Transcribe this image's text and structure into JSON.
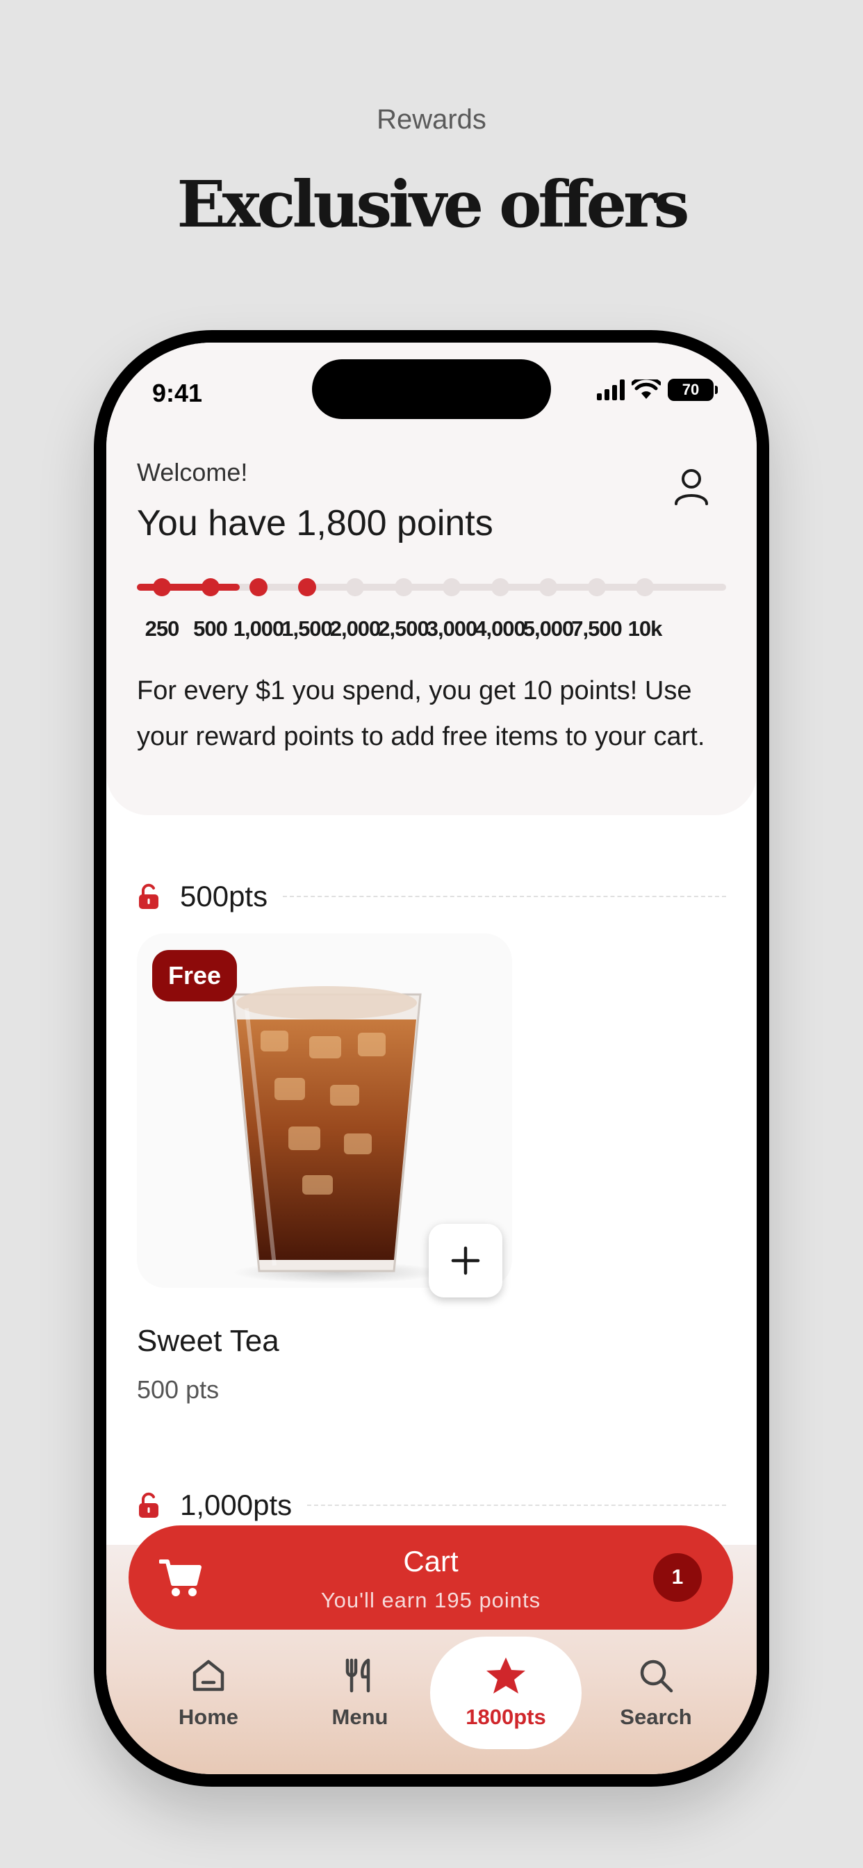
{
  "hero": {
    "subtitle": "Rewards",
    "title": "Exclusive offers"
  },
  "status_bar": {
    "time": "9:41",
    "battery": "70"
  },
  "rewards": {
    "welcome": "Welcome!",
    "points_headline": "You have 1,800 points",
    "current_points": 1800,
    "progress_fraction": 0.175,
    "milestones": [
      "250",
      "500",
      "1,000",
      "1,500",
      "2,000",
      "2,500",
      "3,000",
      "4,000",
      "5,000",
      "7,500",
      "10k"
    ],
    "milestones_reached": 4,
    "info_text": "For every $1 you spend, you get 10 points! Use your reward points to add free items to your cart."
  },
  "sections": [
    {
      "label": "500pts"
    },
    {
      "label": "1,000pts"
    }
  ],
  "product": {
    "badge": "Free",
    "name": "Sweet Tea",
    "points": "500 pts"
  },
  "cart": {
    "title": "Cart",
    "subtitle": "You'll earn 195 points",
    "count": "1"
  },
  "tabs": [
    {
      "label": "Home",
      "icon": "home-icon"
    },
    {
      "label": "Menu",
      "icon": "fork-knife-icon"
    },
    {
      "label": "1800pts",
      "icon": "star-icon",
      "active": true
    },
    {
      "label": "Search",
      "icon": "search-icon"
    }
  ],
  "colors": {
    "brand_red": "#d8302b",
    "dark_red": "#8d0a0a",
    "background": "#e4e4e4"
  }
}
